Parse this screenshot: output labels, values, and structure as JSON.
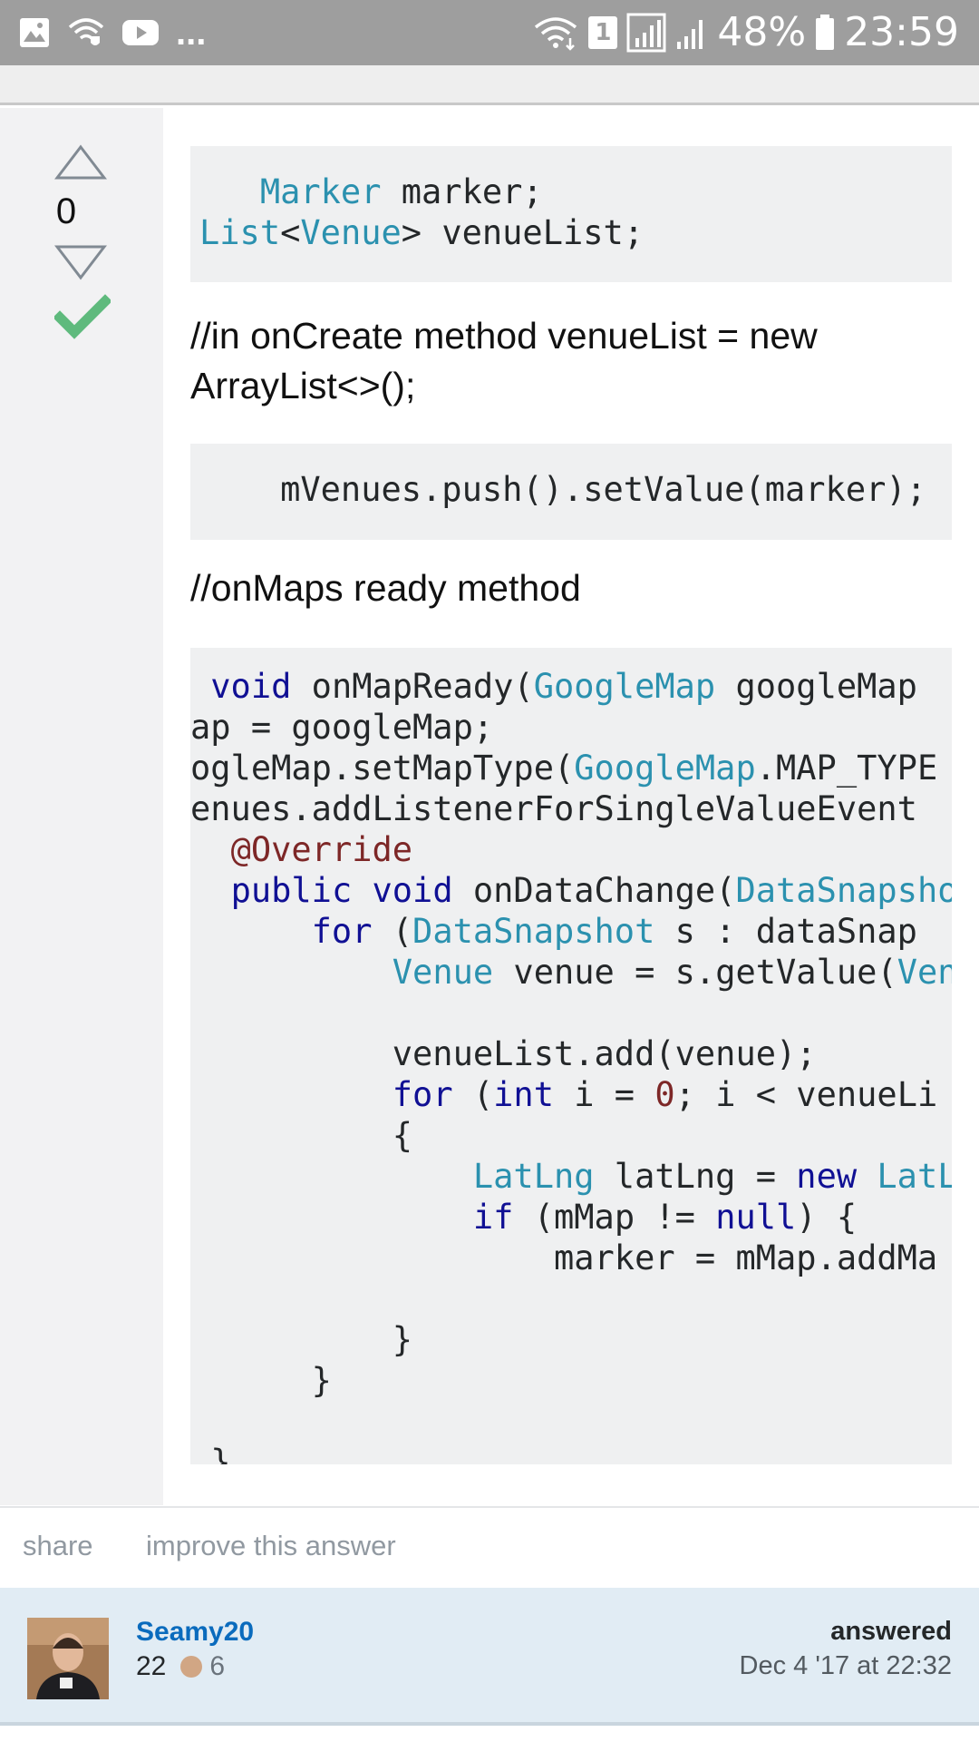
{
  "status_bar": {
    "battery": "48%",
    "time": "23:59",
    "sim_slot": "1",
    "notifications_more": "...",
    "icons": [
      "gallery-icon",
      "wifi-shield-icon",
      "youtube-icon",
      "wifi-icon",
      "signal-icon",
      "battery-icon"
    ]
  },
  "vote": {
    "count": "0",
    "accepted": true
  },
  "code_block_1": {
    "lines": [
      [
        {
          "t": "   "
        },
        {
          "t": "Marker",
          "c": "ty"
        },
        {
          "t": " marker;"
        }
      ],
      [
        {
          "t": ""
        },
        {
          "t": "List",
          "c": "ty"
        },
        {
          "t": "<"
        },
        {
          "t": "Venue",
          "c": "ty"
        },
        {
          "t": "> venueList;"
        }
      ]
    ]
  },
  "paragraph_1": "//in onCreate method venueList = new ArrayList<>();",
  "code_block_2": {
    "lines": [
      [
        {
          "t": "    mVenues.push().setValue(marker);"
        }
      ]
    ]
  },
  "paragraph_2": "//onMaps ready method",
  "code_block_3": {
    "lines": [
      [
        {
          "t": " "
        },
        {
          "t": "void",
          "c": "kw"
        },
        {
          "t": " onMapReady("
        },
        {
          "t": "GoogleMap",
          "c": "ty"
        },
        {
          "t": " googleMap"
        }
      ],
      [
        {
          "t": "ap = googleMap;"
        }
      ],
      [
        {
          "t": "ogleMap.setMapType("
        },
        {
          "t": "GoogleMap",
          "c": "ty"
        },
        {
          "t": ".MAP_TYPE"
        }
      ],
      [
        {
          "t": "enues.addListenerForSingleValueEvent"
        }
      ],
      [
        {
          "t": "  "
        },
        {
          "t": "@Override",
          "c": "an"
        }
      ],
      [
        {
          "t": "  "
        },
        {
          "t": "public",
          "c": "kw"
        },
        {
          "t": " "
        },
        {
          "t": "void",
          "c": "kw"
        },
        {
          "t": " onDataChange("
        },
        {
          "t": "DataSnapshot",
          "c": "ty"
        }
      ],
      [
        {
          "t": "      "
        },
        {
          "t": "for",
          "c": "kw"
        },
        {
          "t": " ("
        },
        {
          "t": "DataSnapshot",
          "c": "ty"
        },
        {
          "t": " s : dataSnap"
        }
      ],
      [
        {
          "t": "          "
        },
        {
          "t": "Venue",
          "c": "ty"
        },
        {
          "t": " venue = s.getValue("
        },
        {
          "t": "Venue",
          "c": "ty"
        }
      ],
      [
        {
          "t": ""
        }
      ],
      [
        {
          "t": "          venueList.add(venue);"
        }
      ],
      [
        {
          "t": "          "
        },
        {
          "t": "for",
          "c": "kw"
        },
        {
          "t": " ("
        },
        {
          "t": "int",
          "c": "kw"
        },
        {
          "t": " i = "
        },
        {
          "t": "0",
          "c": "nu"
        },
        {
          "t": "; i < venueLi"
        }
      ],
      [
        {
          "t": "          {"
        }
      ],
      [
        {
          "t": "              "
        },
        {
          "t": "LatLng",
          "c": "ty"
        },
        {
          "t": " latLng = "
        },
        {
          "t": "new",
          "c": "kw"
        },
        {
          "t": " "
        },
        {
          "t": "LatLng",
          "c": "ty"
        }
      ],
      [
        {
          "t": "              "
        },
        {
          "t": "if",
          "c": "kw"
        },
        {
          "t": " (mMap != "
        },
        {
          "t": "null",
          "c": "kw"
        },
        {
          "t": ") {"
        }
      ],
      [
        {
          "t": "                  marker = mMap.addMa"
        }
      ],
      [
        {
          "t": ""
        }
      ],
      [
        {
          "t": "          }"
        }
      ],
      [
        {
          "t": "      }"
        }
      ],
      [
        {
          "t": ""
        }
      ],
      [
        {
          "t": " }"
        }
      ]
    ]
  },
  "actions": {
    "share": "share",
    "improve": "improve this answer"
  },
  "user": {
    "name": "Seamy20",
    "reputation": "22",
    "bronze_badges": "6",
    "answered_label": "answered",
    "answered_date": "Dec 4 '17 at 22:32"
  },
  "colors": {
    "type": "#2b91af",
    "keyword": "#101094",
    "annotation": "#7d2727",
    "link": "#0a6bbd",
    "accepted": "#5fba7d",
    "card_bg": "#e1ecf4"
  }
}
